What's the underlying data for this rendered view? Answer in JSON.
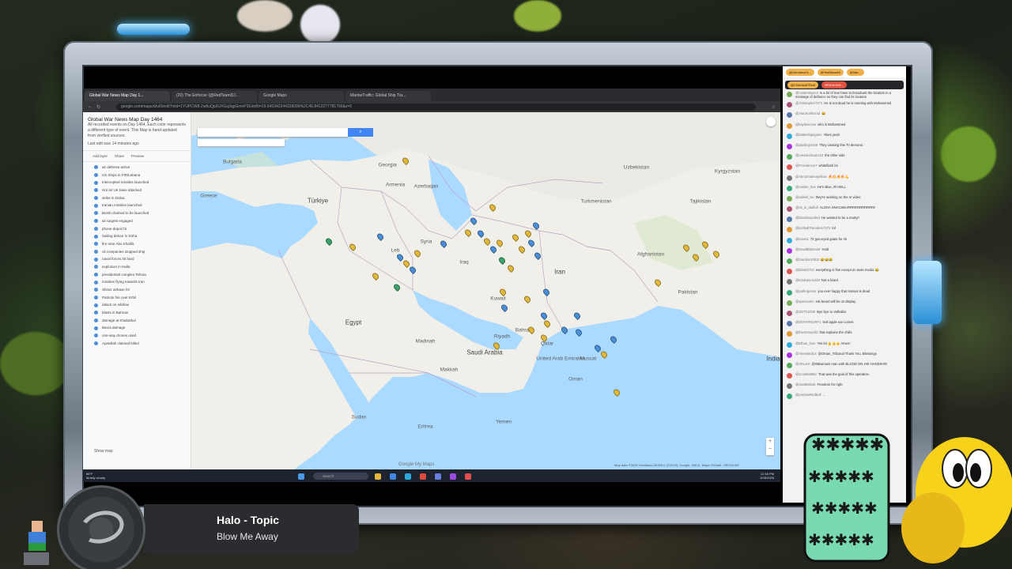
{
  "browser": {
    "tabs": [
      {
        "label": "Global War News Map Day 1...",
        "active": true
      },
      {
        "label": "(20) The Enforcer (@RedTeamDJ...",
        "active": false
      },
      {
        "label": "Google Maps",
        "active": false
      },
      {
        "label": "MarineTraffic: Global Ship Tra...",
        "active": false
      }
    ],
    "url": "google.com/maps/d/u/0/edit?mid=1YUPCW8-2w6uQp3UXGq3qpGmnP2EdoBI=29.645342344328099%2C45.8412277781766&z=5"
  },
  "sidebar": {
    "title": "Global War News Map Day 1464",
    "description": "All recorded events on Day 1464. Each color represents a different type of event. This Map is hand-updated from verified sources.",
    "last_edit": "Last edit was 14 minutes ago",
    "actions": {
      "add_layer": "Add layer",
      "share": "Share",
      "preview": "Preview"
    },
    "items": [
      "air defense active",
      "US Ships in FIR/Lebana",
      "Intercepted missiles launched",
      "Hot air UK base attacked",
      "strike in Dubai",
      "Iranian missiles launched",
      "Bomb claimed to be launched",
      "air targets engaged",
      "phone depot hit",
      "Sailing detour in Doha",
      "fire near Abu Khalifa",
      "oil companies stopped ship",
      "naval forces hit hard",
      "explosion in Haifa",
      "presidential complex Tehran",
      "missiles flying towards Iran",
      "Shiraz airbase hit",
      "Patriots fire over Erbil",
      "attack on Isfahan",
      "blasts in Bahrain",
      "damage at Khabarkal",
      "Basra damage",
      "one-way drones used",
      "Ayatollah claimed killed"
    ],
    "footer": "Show map"
  },
  "map": {
    "search_button": "Search",
    "copyright": "Map data ©2026 GeoBasis-DE/BKG (©2009), Google, INEGI, Mapa GISrael, ORION-ME",
    "watermark": "Google My Maps",
    "labels": [
      {
        "text": "Bulgaria"
      },
      {
        "text": "Greece"
      },
      {
        "text": "Türkiye",
        "big": true
      },
      {
        "text": "Georgia"
      },
      {
        "text": "Armenia"
      },
      {
        "text": "Azerbaijan"
      },
      {
        "text": "Uzbekistan"
      },
      {
        "text": "Kyrgyzstan"
      },
      {
        "text": "Tajikistan"
      },
      {
        "text": "Turkmenistan"
      },
      {
        "text": "Syria"
      },
      {
        "text": "Leb"
      },
      {
        "text": "Iraq"
      },
      {
        "text": "Iran",
        "big": true
      },
      {
        "text": "Afghanistan"
      },
      {
        "text": "Pakistan"
      },
      {
        "text": "Kuwait"
      },
      {
        "text": "Egypt",
        "big": true
      },
      {
        "text": "Saudi Arabia",
        "big": true
      },
      {
        "text": "Bahrain"
      },
      {
        "text": "Qatar"
      },
      {
        "text": "United Arab Emirates"
      },
      {
        "text": "Oman"
      },
      {
        "text": "India",
        "big": true
      },
      {
        "text": "Sudan"
      },
      {
        "text": "Yemen"
      },
      {
        "text": "Eritrea"
      },
      {
        "text": "Muscat"
      },
      {
        "text": "Madinah"
      },
      {
        "text": "Makkah"
      },
      {
        "text": "Riyadh"
      }
    ]
  },
  "taskbar": {
    "weather_temp": "86°F",
    "weather_desc": "Mostly cloudy",
    "search": "Search",
    "time": "12:48 PM",
    "date": "3/28/2026"
  },
  "chat": {
    "header_pills": [
      "@GemianoCr...",
      "@YesMaxwell",
      "@Inte..."
    ],
    "pinned": [
      "@Ch3mical7Rold",
      "BREAKING..."
    ],
    "messages": [
      {
        "user": "@noidentityse2",
        "text": "is a bit of Iran have to broadcast the location in a message of defiance so they can find its location"
      },
      {
        "user": "@christopher7271",
        "text": "He is not dead he is meeting with Mohammed"
      },
      {
        "user": "@AlanKooks1nd",
        "text": "😂"
      },
      {
        "user": "@kaylieecrow",
        "text": "who is Mohammed"
      },
      {
        "user": "@battleshipsgone",
        "text": "Yikes yeah"
      },
      {
        "user": "@alanboy3346",
        "text": "They ceasing this 70 demonic"
      },
      {
        "user": "@cassandraa2134",
        "text": "the other side"
      },
      {
        "user": "@Providence7",
        "text": "whiteflash lol"
      },
      {
        "user": "@Abnormalnotyellow",
        "text": "🔥💥🔥🔥💪"
      },
      {
        "user": "@ruislan_has",
        "text": "He's alive, IN HELL"
      },
      {
        "user": "@adwell_lsv",
        "text": "they're working on the AI video"
      },
      {
        "user": "@c5_is_dadfull",
        "text": "ALOHA SNACKBARRRRRRRRRRR!!"
      },
      {
        "user": "@bloodbounded",
        "text": "He wanted to be a martyr!"
      },
      {
        "user": "@keithallTheodore7272",
        "text": "lol"
      },
      {
        "user": "@tones1",
        "text": "72 goo-eyed goats for Ali"
      },
      {
        "user": "@DavidBlanton8",
        "text": "Hold"
      },
      {
        "user": "@brandonG0b3",
        "text": "😂😂😂"
      },
      {
        "user": "@ibbott2722",
        "text": "everything is fine except on main media 😂"
      },
      {
        "user": "@tehdraw-tc248",
        "text": "Not a lizard"
      },
      {
        "user": "@patfergeson",
        "text": "you ever happy that Hamas is dead"
      },
      {
        "user": "@spencartin",
        "text": "His beard will be on display"
      },
      {
        "user": "@SDTG2035",
        "text": "Bye bye to Valhallar"
      },
      {
        "user": "@DEFARNGRF1",
        "text": "Sell apple ear comes"
      },
      {
        "user": "@theSmsworld",
        "text": "that explains the chills"
      },
      {
        "user": "@Ethan_Gee",
        "text": "Yes lol 👍👍👍 Amen!"
      },
      {
        "user": "@YeesMedics",
        "text": "@Oman_Tribunal Thank You, Blessings"
      },
      {
        "user": "@r0rvv1rt",
        "text": "@r0Bwmuss man with BLOOD ON HIS HANDS!!!!!!"
      },
      {
        "user": "@scootle8882",
        "text": "That was the goal of this operation."
      },
      {
        "user": "@Jwatts5bub",
        "text": "Freedom for right"
      },
      {
        "user": "@peebeeRedbull",
        "text": "..."
      }
    ]
  },
  "now_playing": {
    "title": "Halo - Topic",
    "subtitle": "Blow Me Away"
  }
}
